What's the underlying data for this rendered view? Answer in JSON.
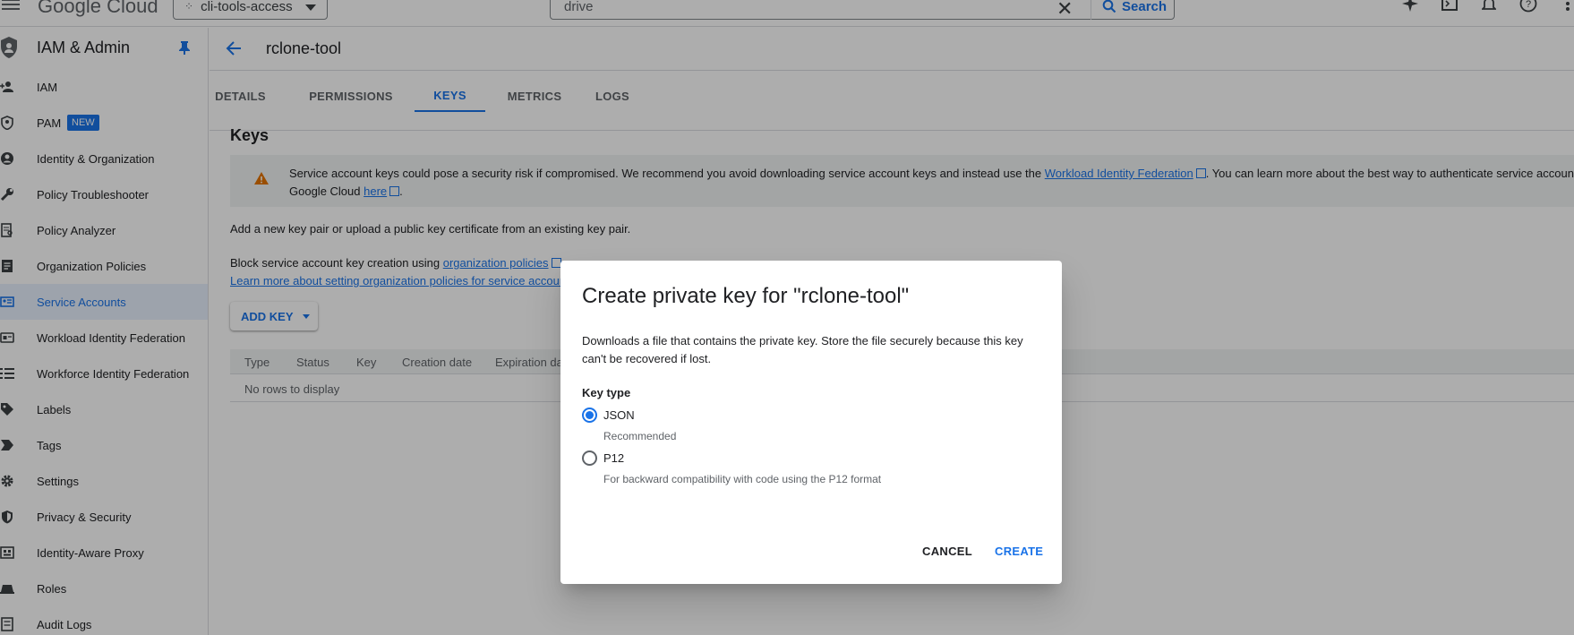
{
  "header": {
    "logo_text_google": "Google",
    "logo_text_cloud": "Cloud",
    "project": "cli-tools-access",
    "search": {
      "value": "drive",
      "button_label": "Search"
    }
  },
  "sidebar": {
    "title": "IAM & Admin",
    "items": [
      {
        "label": "IAM",
        "icon": "add-person-icon"
      },
      {
        "label": "PAM",
        "icon": "shield-account-icon",
        "badge": "NEW"
      },
      {
        "label": "Identity & Organization",
        "icon": "account-circle-icon"
      },
      {
        "label": "Policy Troubleshooter",
        "icon": "wrench-icon"
      },
      {
        "label": "Policy Analyzer",
        "icon": "document-search-icon"
      },
      {
        "label": "Organization Policies",
        "icon": "list-document-icon"
      },
      {
        "label": "Service Accounts",
        "icon": "service-account-icon",
        "active": true
      },
      {
        "label": "Workload Identity Federation",
        "icon": "id-card-icon"
      },
      {
        "label": "Workforce Identity Federation",
        "icon": "list-icon"
      },
      {
        "label": "Labels",
        "icon": "label-icon"
      },
      {
        "label": "Tags",
        "icon": "tag-icon"
      },
      {
        "label": "Settings",
        "icon": "gear-icon"
      },
      {
        "label": "Privacy & Security",
        "icon": "shield-icon"
      },
      {
        "label": "Identity-Aware Proxy",
        "icon": "proxy-icon"
      },
      {
        "label": "Roles",
        "icon": "roles-icon"
      },
      {
        "label": "Audit Logs",
        "icon": "audit-log-icon"
      }
    ]
  },
  "page": {
    "title": "rclone-tool",
    "tabs": [
      "DETAILS",
      "PERMISSIONS",
      "KEYS",
      "METRICS",
      "LOGS"
    ],
    "active_tab": "KEYS",
    "section_title": "Keys",
    "warning": {
      "part1": "Service account keys could pose a security risk if compromised. We recommend you avoid downloading service account keys and instead use the ",
      "link1": "Workload Identity Federation",
      "part2": ". You can learn more about the best way to authenticate service accounts on",
      "part3": "Google Cloud ",
      "link2": "here",
      "part4": "."
    },
    "add_pair_text": "Add a new key pair or upload a public key certificate from an existing key pair.",
    "block_text": "Block service account key creation using ",
    "block_link": "organization policies",
    "learn_more_link": "Learn more about setting organization policies for service accounts",
    "add_key_label": "ADD KEY",
    "table": {
      "columns": [
        "Type",
        "Status",
        "Key",
        "Creation date",
        "Expiration date"
      ],
      "empty_text": "No rows to display"
    }
  },
  "dialog": {
    "title": "Create private key for \"rclone-tool\"",
    "description": "Downloads a file that contains the private key. Store the file securely because this key can't be recovered if lost.",
    "key_type_label": "Key type",
    "options": [
      {
        "label": "JSON",
        "hint": "Recommended",
        "checked": true
      },
      {
        "label": "P12",
        "hint": "For backward compatibility with code using the P12 format",
        "checked": false
      }
    ],
    "cancel_label": "CANCEL",
    "create_label": "CREATE"
  },
  "colors": {
    "accent": "#1a73e8",
    "warning": "#e37400",
    "active_bg": "#e8f0fe"
  }
}
